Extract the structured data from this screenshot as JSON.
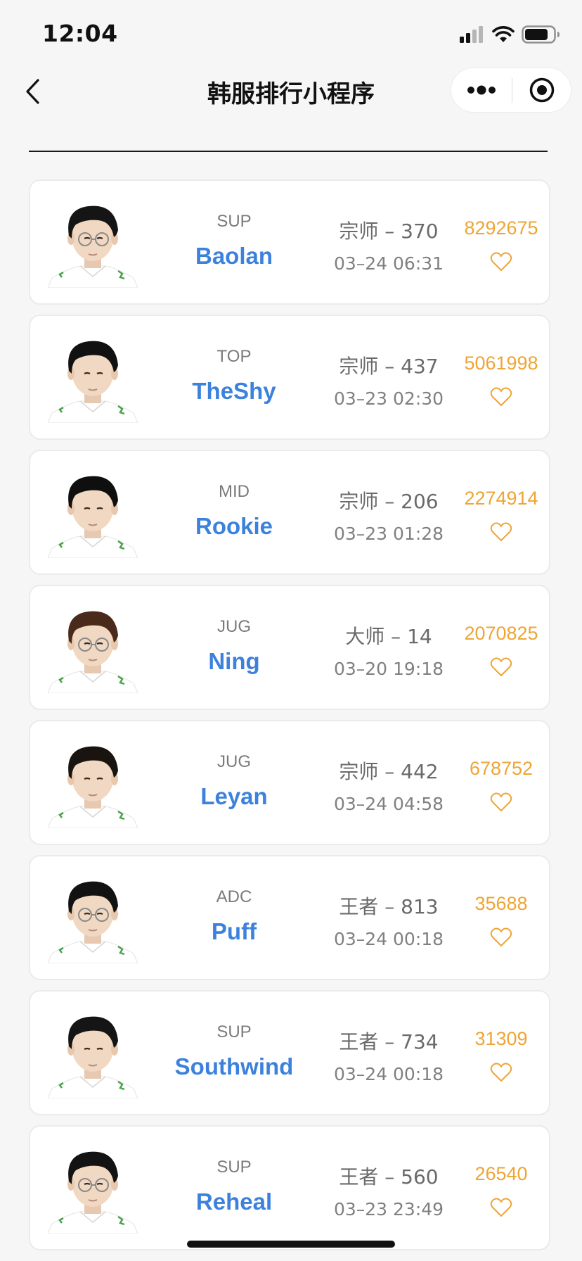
{
  "status_bar": {
    "time": "12:04",
    "icons": [
      "signal-icon",
      "wifi-icon",
      "battery-icon"
    ]
  },
  "nav": {
    "title": "韩服排行小程序",
    "back_icon": "chevron-left-icon",
    "more_icon": "more-dots-icon",
    "close_icon": "target-close-icon"
  },
  "colors": {
    "name_blue": "#3c82dc",
    "score_orange": "#eea535",
    "card_border": "#ebebeb",
    "background": "#f6f6f6"
  },
  "players": [
    {
      "role": "SUP",
      "name": "Baolan",
      "rank": "宗师 – 370",
      "time": "03–24 06:31",
      "score": "8292675",
      "hair": "#151515",
      "glasses": true
    },
    {
      "role": "TOP",
      "name": "TheShy",
      "rank": "宗师 – 437",
      "time": "03–23 02:30",
      "score": "5061998",
      "hair": "#111111",
      "glasses": false
    },
    {
      "role": "MID",
      "name": "Rookie",
      "rank": "宗师 – 206",
      "time": "03–23 01:28",
      "score": "2274914",
      "hair": "#0f0f0f",
      "glasses": false
    },
    {
      "role": "JUG",
      "name": "Ning",
      "rank": "大师 – 14",
      "time": "03–20 19:18",
      "score": "2070825",
      "hair": "#4a2a1a",
      "glasses": true
    },
    {
      "role": "JUG",
      "name": "Leyan",
      "rank": "宗师 – 442",
      "time": "03–24 04:58",
      "score": "678752",
      "hair": "#1a1410",
      "glasses": false
    },
    {
      "role": "ADC",
      "name": "Puff",
      "rank": "王者 – 813",
      "time": "03–24 00:18",
      "score": "35688",
      "hair": "#121212",
      "glasses": true
    },
    {
      "role": "SUP",
      "name": "Southwind",
      "rank": "王者 – 734",
      "time": "03–24 00:18",
      "score": "31309",
      "hair": "#151515",
      "glasses": false
    },
    {
      "role": "SUP",
      "name": "Reheal",
      "rank": "王者 – 560",
      "time": "03–23 23:49",
      "score": "26540",
      "hair": "#131313",
      "glasses": true
    }
  ]
}
